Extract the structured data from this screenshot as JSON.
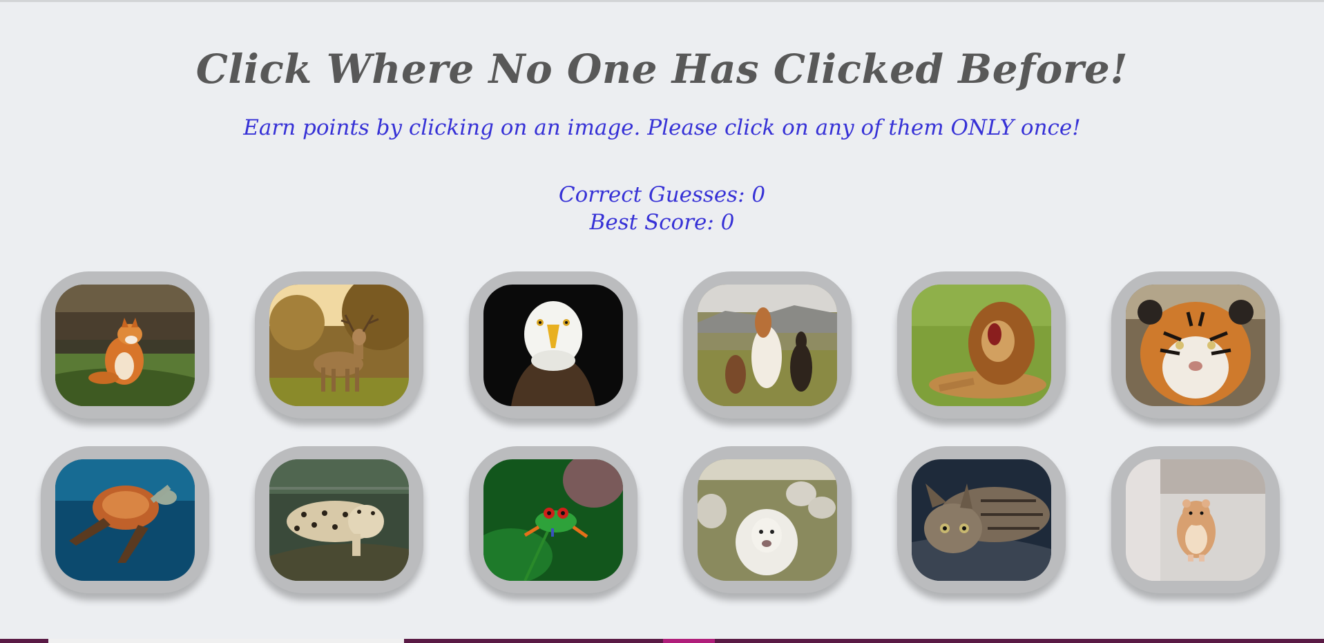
{
  "header": {
    "title": "Click Where No One Has Clicked Before!",
    "subtitle": "Earn points by clicking on an image. Please click on any of them ONLY once!"
  },
  "scores": {
    "correct_label": "Correct Guesses: 0",
    "best_label": "Best Score: 0"
  },
  "cards": [
    {
      "animal": "fox",
      "icon": "fox-image"
    },
    {
      "animal": "deer",
      "icon": "deer-image"
    },
    {
      "animal": "eagle",
      "icon": "eagle-image"
    },
    {
      "animal": "horses",
      "icon": "horses-image"
    },
    {
      "animal": "lion",
      "icon": "lion-image"
    },
    {
      "animal": "tiger",
      "icon": "tiger-image"
    },
    {
      "animal": "sea turtle",
      "icon": "turtle-image"
    },
    {
      "animal": "leopard",
      "icon": "leopard-image"
    },
    {
      "animal": "frog",
      "icon": "frog-image"
    },
    {
      "animal": "sheep",
      "icon": "sheep-image"
    },
    {
      "animal": "kitten",
      "icon": "kitten-image"
    },
    {
      "animal": "hamster",
      "icon": "hamster-image"
    }
  ],
  "colors": {
    "background": "#eceef1",
    "title": "#585858",
    "accent": "#3631d6",
    "card_frame": "#bbbcbe",
    "bottom_bar": "#5a1a45"
  }
}
